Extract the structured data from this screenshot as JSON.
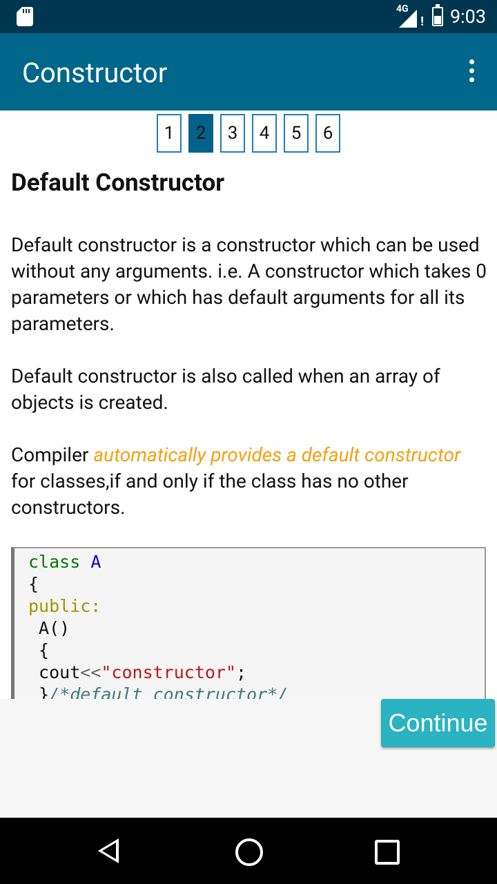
{
  "status_bar": {
    "time": "9:03",
    "network": "4G"
  },
  "app_bar": {
    "title": "Constructor"
  },
  "pager": {
    "pages": [
      "1",
      "2",
      "3",
      "4",
      "5",
      "6"
    ],
    "active_index": 1
  },
  "content": {
    "heading": "Default Constructor",
    "para1": "Default constructor is a constructor which can be used without any arguments.  i.e. A constructor which takes 0 parameters or which has default arguments for all its parameters.",
    "para2": "Default constructor is also called when an array of objects is created.",
    "para3_prefix": "Compiler ",
    "para3_highlight": "automatically provides a default constructor",
    "para3_suffix": " for classes,if and only if the class has no other constructors."
  },
  "code": {
    "kw_class": "class",
    "class_name": "A",
    "open_brace": "{",
    "access": "public:",
    "ctor": " A()",
    "inner_open": " {",
    "cout": " cout",
    "op": "<<",
    "string": "\"constructor\"",
    "semicolon": ";",
    "inner_close": " }",
    "comment": "/*default constructor*/"
  },
  "actions": {
    "continue_label": "Continue"
  },
  "colors": {
    "app_bar": "#00668a",
    "status_bar": "#00364f",
    "highlight": "#f5a012",
    "continue_button": "#2ab3c1"
  }
}
